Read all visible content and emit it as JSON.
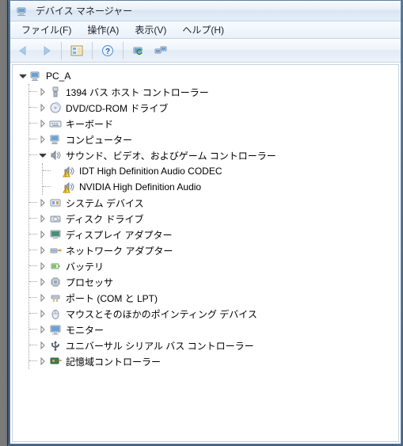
{
  "window": {
    "title": "デバイス マネージャー"
  },
  "menu": {
    "file": "ファイル(F)",
    "action": "操作(A)",
    "view": "表示(V)",
    "help": "ヘルプ(H)"
  },
  "toolbar": {
    "back": "back-icon",
    "forward": "forward-icon",
    "console": "console-tree-icon",
    "help": "help-icon",
    "refresh": "refresh-icon",
    "scan": "scan-hardware-icon"
  },
  "tree": {
    "root": {
      "label": "PC_A",
      "iconName": "computer-icon",
      "expanded": true
    },
    "nodes": [
      {
        "label": "1394 バス ホスト コントローラー",
        "iconName": "ieee1394-icon",
        "expanded": false
      },
      {
        "label": "DVD/CD-ROM ドライブ",
        "iconName": "optical-drive-icon",
        "expanded": false
      },
      {
        "label": "キーボード",
        "iconName": "keyboard-icon",
        "expanded": false
      },
      {
        "label": "コンピューター",
        "iconName": "computer-icon",
        "expanded": false
      },
      {
        "label": "サウンド、ビデオ、およびゲーム コントローラー",
        "iconName": "sound-icon",
        "expanded": true,
        "children": [
          {
            "label": "IDT High Definition Audio CODEC",
            "iconName": "sound-icon",
            "warning": true
          },
          {
            "label": "NVIDIA High Definition Audio",
            "iconName": "sound-icon",
            "warning": true
          }
        ]
      },
      {
        "label": "システム デバイス",
        "iconName": "system-device-icon",
        "expanded": false
      },
      {
        "label": "ディスク ドライブ",
        "iconName": "disk-drive-icon",
        "expanded": false
      },
      {
        "label": "ディスプレイ アダプター",
        "iconName": "display-adapter-icon",
        "expanded": false
      },
      {
        "label": "ネットワーク アダプター",
        "iconName": "network-adapter-icon",
        "expanded": false
      },
      {
        "label": "バッテリ",
        "iconName": "battery-icon",
        "expanded": false
      },
      {
        "label": "プロセッサ",
        "iconName": "processor-icon",
        "expanded": false
      },
      {
        "label": "ポート (COM と LPT)",
        "iconName": "port-icon",
        "expanded": false
      },
      {
        "label": "マウスとそのほかのポインティング デバイス",
        "iconName": "mouse-icon",
        "expanded": false
      },
      {
        "label": "モニター",
        "iconName": "monitor-icon",
        "expanded": false
      },
      {
        "label": "ユニバーサル シリアル バス コントローラー",
        "iconName": "usb-icon",
        "expanded": false
      },
      {
        "label": "記憶域コントローラー",
        "iconName": "storage-controller-icon",
        "expanded": false
      }
    ]
  }
}
